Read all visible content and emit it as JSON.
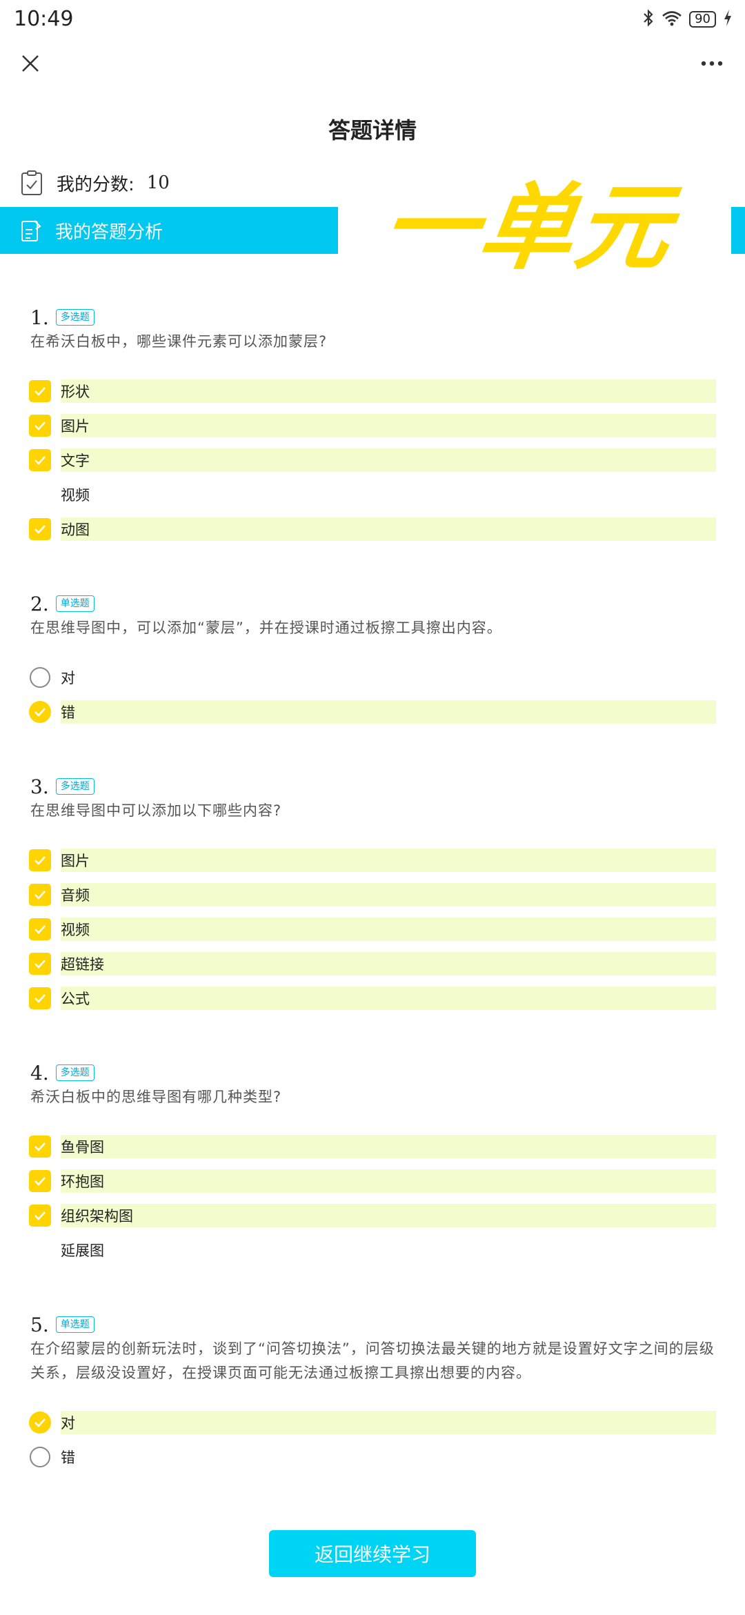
{
  "status": {
    "time": "10:49",
    "battery": "90"
  },
  "header": {
    "title": "答题详情",
    "close_icon": "close-icon",
    "more_icon": "more-icon"
  },
  "score": {
    "label": "我的分数:",
    "value": "10"
  },
  "analysis": {
    "label": "我的答题分析"
  },
  "banner": {
    "text": "一单元"
  },
  "questions": [
    {
      "num": "1.",
      "type": "多选题",
      "text": "在希沃白板中，哪些课件元素可以添加蒙层?",
      "mode": "multi",
      "options": [
        {
          "label": "形状",
          "selected": true
        },
        {
          "label": "图片",
          "selected": true
        },
        {
          "label": "文字",
          "selected": true
        },
        {
          "label": "视频",
          "selected": false
        },
        {
          "label": "动图",
          "selected": true
        }
      ]
    },
    {
      "num": "2.",
      "type": "单选题",
      "text": "在思维导图中，可以添加“蒙层”，并在授课时通过板擦工具擦出内容。",
      "mode": "single",
      "options": [
        {
          "label": "对",
          "selected": false
        },
        {
          "label": "错",
          "selected": true
        }
      ]
    },
    {
      "num": "3.",
      "type": "多选题",
      "text": "在思维导图中可以添加以下哪些内容?",
      "mode": "multi",
      "options": [
        {
          "label": "图片",
          "selected": true
        },
        {
          "label": "音频",
          "selected": true
        },
        {
          "label": "视频",
          "selected": true
        },
        {
          "label": "超链接",
          "selected": true
        },
        {
          "label": "公式",
          "selected": true
        }
      ]
    },
    {
      "num": "4.",
      "type": "多选题",
      "text": "希沃白板中的思维导图有哪几种类型?",
      "mode": "multi",
      "options": [
        {
          "label": "鱼骨图",
          "selected": true
        },
        {
          "label": "环抱图",
          "selected": true
        },
        {
          "label": "组织架构图",
          "selected": true
        },
        {
          "label": "延展图",
          "selected": false
        }
      ]
    },
    {
      "num": "5.",
      "type": "单选题",
      "text": "在介绍蒙层的创新玩法时，谈到了“问答切换法”，问答切换法最关键的地方就是设置好文字之间的层级关系，层级没设置好，在授课页面可能无法通过板擦工具擦出想要的内容。",
      "mode": "single",
      "options": [
        {
          "label": "对",
          "selected": true
        },
        {
          "label": "错",
          "selected": false
        }
      ]
    }
  ],
  "footer": {
    "back_label": "返回继续学习"
  },
  "colors": {
    "accent": "#00c8f0",
    "selected_bg": "#f3fccd",
    "check": "#ffd400"
  }
}
